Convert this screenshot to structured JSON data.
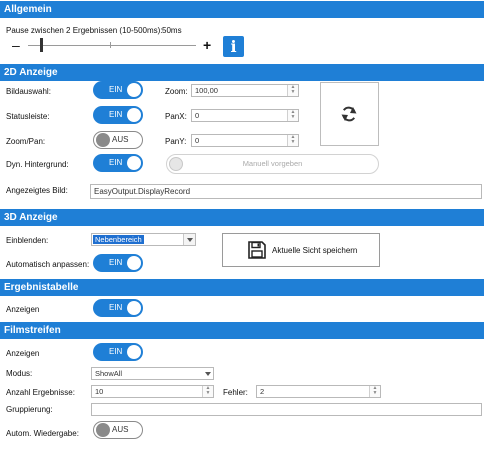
{
  "allgemein": {
    "title": "Allgemein",
    "pause_label": "Pause zwischen 2 Ergebnissen (10-500ms):",
    "pause_value": "50ms",
    "pause_fraction": 0.08,
    "minus": "–",
    "plus": "+",
    "info": "i"
  },
  "anzeige2d": {
    "title": "2D Anzeige",
    "bildauswahl": {
      "label": "Bildauswahl:",
      "state": "EIN"
    },
    "statusleiste": {
      "label": "Statusleiste:",
      "state": "EIN"
    },
    "zoompan": {
      "label": "Zoom/Pan:",
      "state": "AUS"
    },
    "hintergrund": {
      "label": "Dyn. Hintergrund:",
      "state": "EIN"
    },
    "zoom": {
      "label": "Zoom:",
      "value": "100,00"
    },
    "panx": {
      "label": "PanX:",
      "value": "0"
    },
    "pany": {
      "label": "PanY:",
      "value": "0"
    },
    "manuell": "Manuell vorgeben",
    "bild_label": "Angezeigtes Bild:",
    "bild_value": "EasyOutput.DisplayRecord"
  },
  "anzeige3d": {
    "title": "3D Anzeige",
    "einblenden_label": "Einblenden:",
    "einblenden_value": "Nebenbereich",
    "anpassen_label": "Automatisch anpassen:",
    "anpassen_state": "EIN",
    "speichern": "Aktuelle Sicht speichern"
  },
  "ergebnistabelle": {
    "title": "Ergebnistabelle",
    "anzeigen_label": "Anzeigen",
    "anzeigen_state": "EIN"
  },
  "filmstreifen": {
    "title": "Filmstreifen",
    "anzeigen_label": "Anzeigen",
    "anzeigen_state": "EIN",
    "modus_label": "Modus:",
    "modus_value": "ShowAll",
    "anzahl_label": "Anzahl Ergebnisse:",
    "anzahl_value": "10",
    "fehler_label": "Fehler:",
    "fehler_value": "2",
    "gruppierung_label": "Gruppierung:",
    "gruppierung_value": "",
    "autom_label": "Autom. Wiedergabe:",
    "autom_state": "AUS"
  },
  "colors": {
    "accent": "#1f7fd6",
    "header": "#1f7fd6"
  },
  "icons": {
    "refresh": "refresh-icon",
    "save": "floppy-disk-icon",
    "info": "info-icon"
  }
}
